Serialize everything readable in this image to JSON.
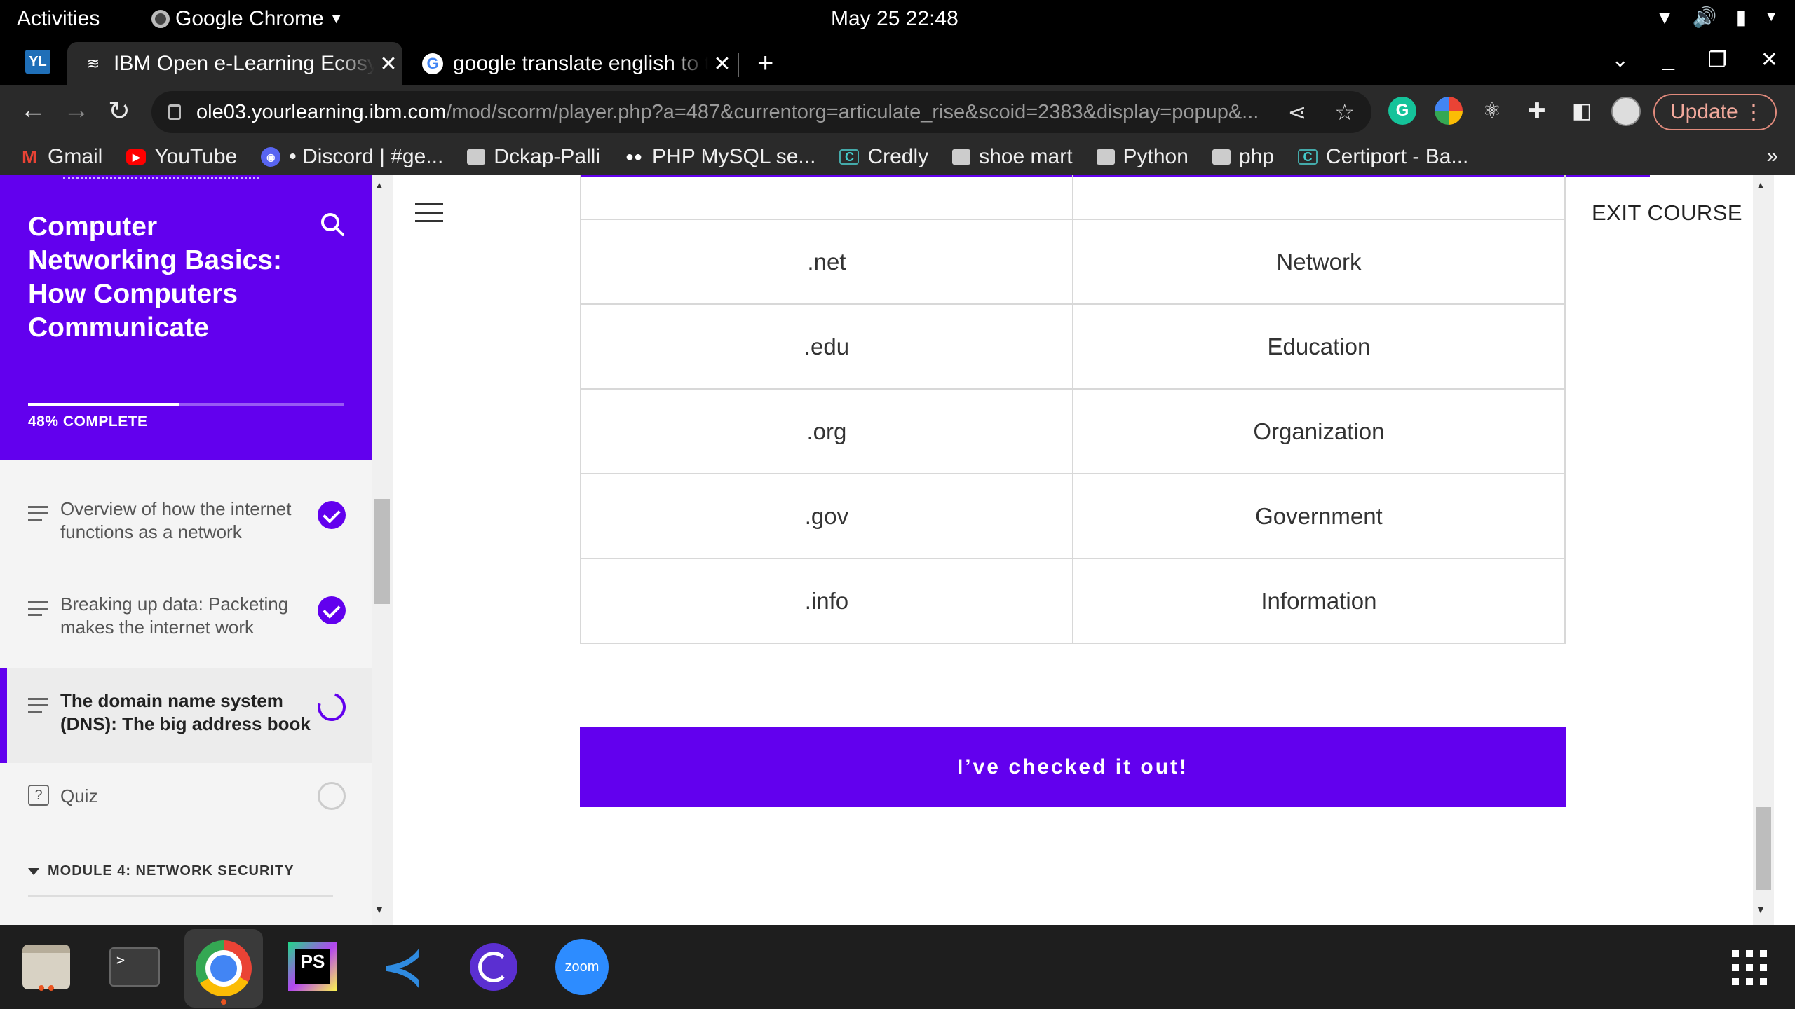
{
  "system": {
    "activities": "Activities",
    "app_name": "Google Chrome",
    "clock": "May 25  22:48"
  },
  "tabs": [
    {
      "title": "IBM Open e-Learning Ecosystem",
      "active": true,
      "icon": "ibm-icon"
    },
    {
      "title": "google translate english to tamil",
      "active": false,
      "icon": "google-icon"
    }
  ],
  "address": {
    "host": "ole03.yourlearning.ibm.com",
    "path": "/mod/scorm/player.php?a=487&currentorg=articulate_rise&scoid=2383&display=popup&..."
  },
  "toolbar": {
    "update_label": "Update"
  },
  "bookmarks": [
    {
      "label": "Gmail",
      "icon": "gmail-icon"
    },
    {
      "label": "YouTube",
      "icon": "youtube-icon"
    },
    {
      "label": "• Discord | #ge...",
      "icon": "discord-icon"
    },
    {
      "label": "Dckap-Palli",
      "icon": "folder-icon"
    },
    {
      "label": "PHP MySQL se...",
      "icon": "medium-icon"
    },
    {
      "label": "Credly",
      "icon": "credly-icon"
    },
    {
      "label": "shoe mart",
      "icon": "folder-icon"
    },
    {
      "label": "Python",
      "icon": "folder-icon"
    },
    {
      "label": "php",
      "icon": "folder-icon"
    },
    {
      "label": "Certiport - Ba...",
      "icon": "credly-icon"
    }
  ],
  "sidebar": {
    "course_title": "Computer Networking Basics: How Computers Communicate",
    "progress_percent": 48,
    "progress_label": "48% COMPLETE",
    "lessons": [
      {
        "label": "Overview of how the internet functions as a network",
        "status": "complete",
        "type": "lesson"
      },
      {
        "label": "Breaking up data: Packeting makes the internet work",
        "status": "complete",
        "type": "lesson"
      },
      {
        "label": "The domain name system (DNS): The big address book",
        "status": "in-progress",
        "type": "lesson"
      },
      {
        "label": "Quiz",
        "status": "not-started",
        "type": "quiz"
      }
    ],
    "module_label": "MODULE 4: NETWORK SECURITY"
  },
  "main": {
    "exit_label": "EXIT COURSE",
    "table_rows": [
      {
        "domain": "",
        "meaning": ""
      },
      {
        "domain": ".net",
        "meaning": "Network"
      },
      {
        "domain": ".edu",
        "meaning": "Education"
      },
      {
        "domain": ".org",
        "meaning": "Organization"
      },
      {
        "domain": ".gov",
        "meaning": "Government"
      },
      {
        "domain": ".info",
        "meaning": "Information"
      }
    ],
    "continue_button": "I’ve checked it out!"
  },
  "dock": {
    "apps": [
      "files-icon",
      "terminal-icon",
      "chrome-icon",
      "phpstorm-icon",
      "vscode-icon",
      "clipgrab-icon",
      "zoom-icon"
    ],
    "zoom_label": "zoom",
    "ps_label": "PS",
    "terminal_label": ">_"
  },
  "colors": {
    "accent": "#6200ee",
    "update_outline": "#e08a7c"
  }
}
